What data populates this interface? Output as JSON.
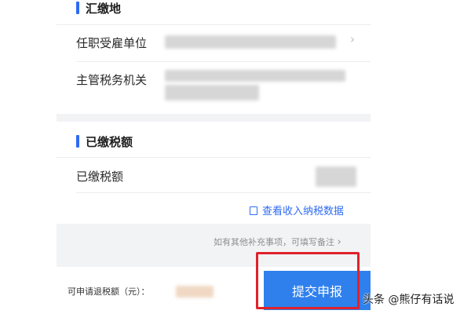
{
  "section_remit": {
    "title": "汇缴地"
  },
  "rows": {
    "employer_label": "任职受雇单位",
    "tax_authority_label": "主管税务机关",
    "chevron": "›"
  },
  "section_paid": {
    "title": "已缴税额"
  },
  "paid_row": {
    "label": "已缴税额"
  },
  "view_link": {
    "icon": "edit-document-icon",
    "text": "查看收入纳税数据"
  },
  "supplement_hint": "如有其他补充事项，可填写备注",
  "bottom": {
    "refund_label": "可申请退税额（元）：",
    "submit_label": "提交申报"
  },
  "watermark": "头条 @熊仔有话说",
  "colors": {
    "accent": "#2f6bf2",
    "button": "#2f80ed",
    "highlight": "#e0222a"
  }
}
